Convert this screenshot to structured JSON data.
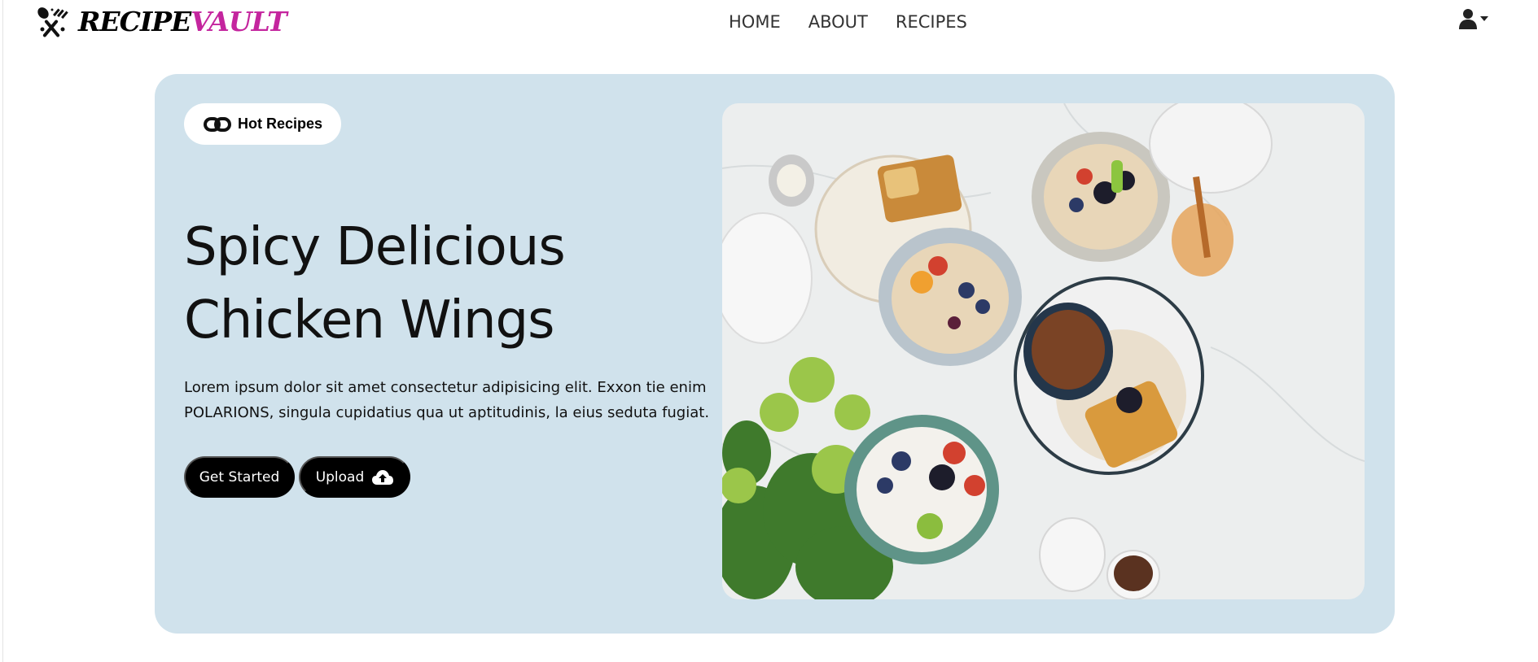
{
  "brand": {
    "name_part1": "RECIPE",
    "name_part2": "VAULT",
    "icon": "utensils-crossed-icon",
    "accent_color": "#c4259e"
  },
  "nav": {
    "links": [
      {
        "label": "HOME"
      },
      {
        "label": "ABOUT"
      },
      {
        "label": "RECIPES"
      }
    ],
    "user_menu_icon": "user-icon",
    "user_menu_caret": "caret-down-icon"
  },
  "hero": {
    "background_color": "#d0e2ec",
    "badge": {
      "label": "Hot Recipes",
      "icon": "link-icon"
    },
    "title_line1": "Spicy Delicious",
    "title_line2": "Chicken Wings",
    "description_line1": "Lorem ipsum dolor sit amet consectetur adipisicing elit. Exxon tie enim",
    "description_line2": "POLARIONS, singula cupidatius qua ut aptitudinis, la eius seduta fugiat.",
    "buttons": {
      "get_started": "Get Started",
      "upload": "Upload",
      "upload_icon": "cloud-upload-icon"
    },
    "photo_subject": "breakfast-spread-photo"
  }
}
